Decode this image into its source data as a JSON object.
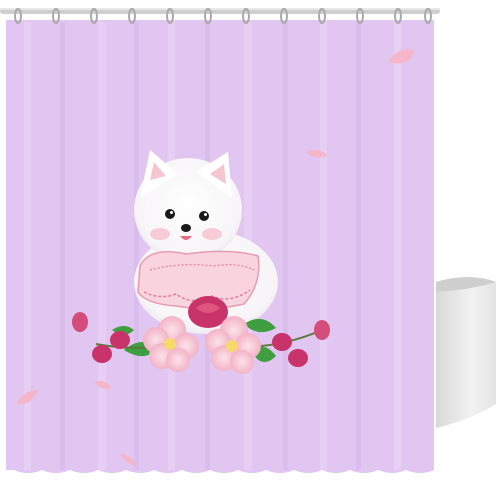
{
  "colors": {
    "background": "#ffffff",
    "curtain": "#e2c6f2",
    "curtain_fold_light": "#ecd8f7",
    "curtain_fold_dark": "#d5b4ea",
    "rod": "#c9c9c9",
    "rings": "#a9a9a9",
    "tub": "#eeeeee",
    "tub_shadow": "#c8c8c8",
    "dog_fur": "#ffffff",
    "collar": "#f7c9d6",
    "petal": "#f4b6c8",
    "blossom_light": "#f6bfd0",
    "blossom_dark": "#c8336a",
    "leaf": "#3f9e3f"
  },
  "scene": {
    "objects": [
      "shower-curtain-rod",
      "curtain-rings",
      "shower-curtain",
      "bathtub",
      "pomeranian-dog",
      "lace-collar",
      "flower-bouquet",
      "falling-petals"
    ]
  }
}
